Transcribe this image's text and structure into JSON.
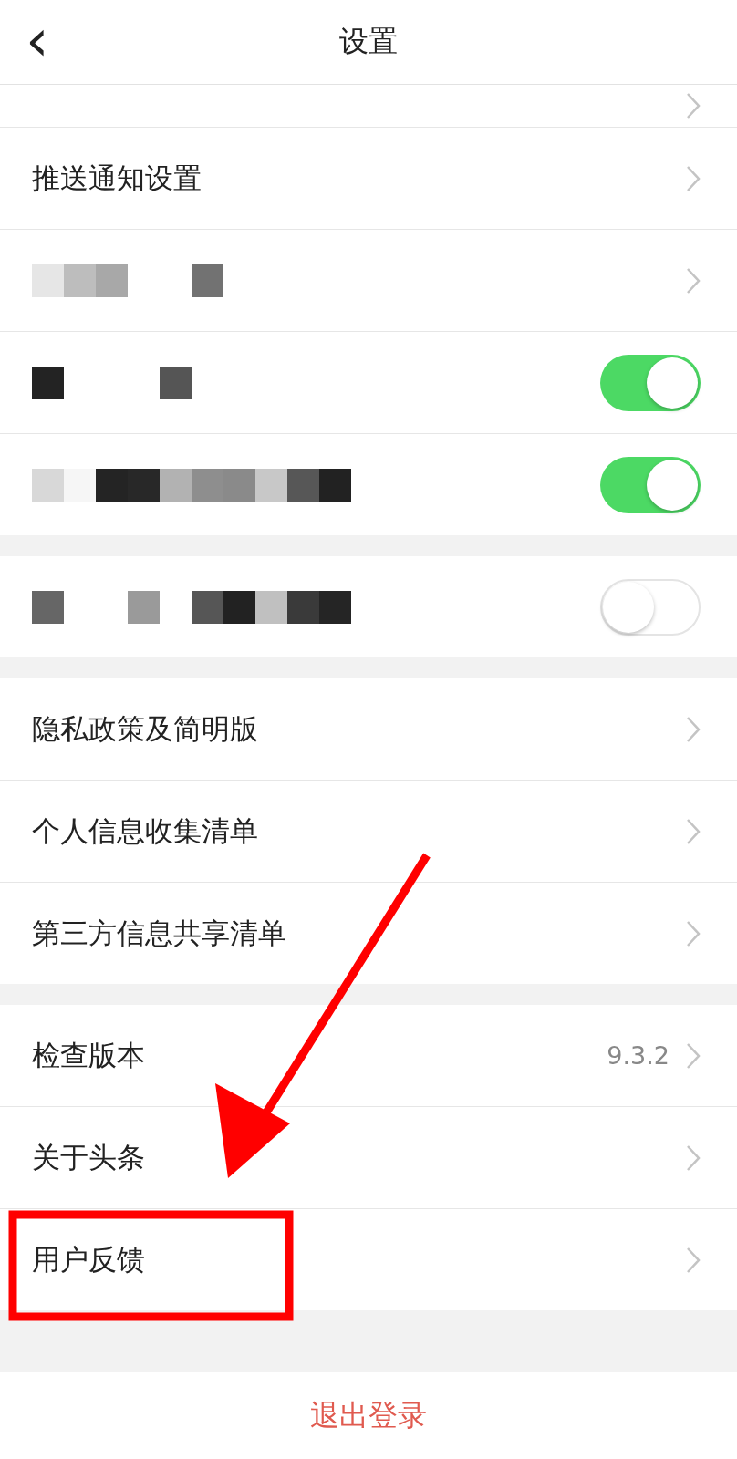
{
  "header": {
    "title": "设置",
    "back": "‹"
  },
  "sections": [
    {
      "rows": [
        {
          "kind": "cut"
        },
        {
          "kind": "link",
          "label": "推送通知设置"
        },
        {
          "kind": "redacted-link"
        },
        {
          "kind": "redacted-toggle",
          "on": true
        },
        {
          "kind": "redacted-toggle",
          "on": true
        }
      ]
    },
    {
      "rows": [
        {
          "kind": "redacted-toggle",
          "on": false
        }
      ]
    },
    {
      "rows": [
        {
          "kind": "link",
          "label": "隐私政策及简明版"
        },
        {
          "kind": "link",
          "label": "个人信息收集清单"
        },
        {
          "kind": "link",
          "label": "第三方信息共享清单"
        }
      ]
    },
    {
      "rows": [
        {
          "kind": "link",
          "label": "检查版本",
          "value": "9.3.2"
        },
        {
          "kind": "link",
          "label": "关于头条"
        },
        {
          "kind": "link",
          "label": "用户反馈"
        }
      ]
    }
  ],
  "logout": {
    "label": "退出登录"
  },
  "annotation": {
    "kind": "arrow-and-frame"
  }
}
